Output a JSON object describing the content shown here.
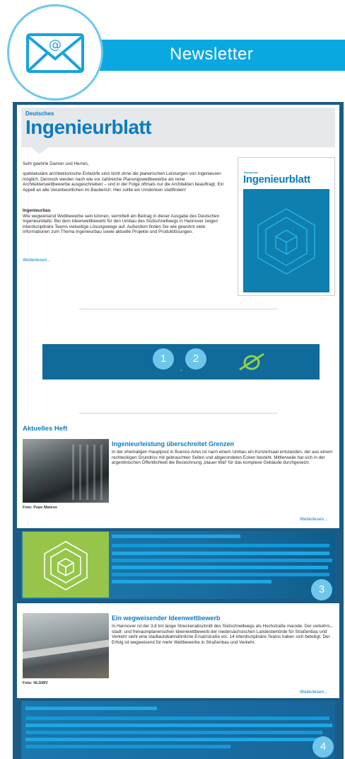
{
  "header": {
    "title": "Newsletter",
    "icon": "envelope-at-icon"
  },
  "brand": {
    "small": "Deutsches",
    "name": "Ingenieurblatt"
  },
  "intro": {
    "greeting": "Sehr geehrte Damen und Herren,",
    "paragraph": "spektakuläre architektonische Entwürfe sind nicht ohne die planerischen Leistungen von Ingenieuren möglich. Dennoch werden nach wie vor zahlreiche Planungswettbewerbe als reine Architektenwettbewerbe ausgeschrieben – und in der Folge oftmals nur die Architekten beauftragt. Ein Appell an alle Verantwortlichen im Bauberich: Hier sollte ein Umdenken stattfinden!",
    "section_title": "Ingenieurbau",
    "section_text": "Wie wegweisend Wettbewerbe sein können, vermittelt ein Beitrag in dieser Ausgabe des Deutschen Ingenieurblatts: Bei dem Ideenwettbewerb für den Umbau des Südschnellwegs in Hannover zeigen interdisziplinäre Teams vielseitige Lösungswege auf. Außerdem finden Sie wie gewohnt viele Informationen zum Thema Ingenieurbau sowie aktuelle Projekte und Produktlösungen.",
    "read_more": "Weiterlesen..."
  },
  "cover": {
    "small": "Deutsches",
    "name": "Ingenieurblatt"
  },
  "banner": {
    "badge1": "1",
    "badge2": "2",
    "separator": ",",
    "icon": "ring-slash-icon"
  },
  "current_issue": {
    "heading": "Aktuelles Heft",
    "title": "Ingenieurleistung überschreitet Grenzen",
    "text": "In der ehemaligen Hauptpost in Buenos Aires ist nach einem Umbau ein Konzertsaal entstanden, der aus einem rechteckigen Grundriss mit gebrauchten Seiten und abgerundeten Ecken besteht. Mittlerweile hat sich in der argentinischen Öffentlichkeit die Bezeichnung „blauer Wal“ für das komplexe Gebäude durchgesetzt.",
    "caption": "Foto: Pepe Mateos",
    "read_more": "Weiterlesen..."
  },
  "promo": {
    "badge": "3",
    "icon": "cube-outline-icon"
  },
  "article2": {
    "title": "Ein wegweisender Ideenwettbewerb",
    "text": "In Hannover ist der 3,8 km lange Streckenabschnitt des Südschnellwegs als Hochstraße marode. Der verkehrs-, stadt- und freiraumplanerischen Ideenwettbewerb der niedersächsischen Landesbehörde für Straßenbau und Verkehr sieht eine stadtautobahnähnliche Ersatzstraße vor. 14 interdisziplinäre Teams haben sich beteiligt. Der Erfolg ist wegweisend für mehr Wettbewerbe in Straßenbau und Verkehr.",
    "caption": "Foto: NLStBV",
    "read_more": "Weiterlesen..."
  },
  "footer_promo": {
    "badge": "4"
  },
  "colors": {
    "accent": "#0aa8e0",
    "brand_blue": "#0b7cc0",
    "frame": "#1b5b86",
    "green": "#97c54a"
  }
}
